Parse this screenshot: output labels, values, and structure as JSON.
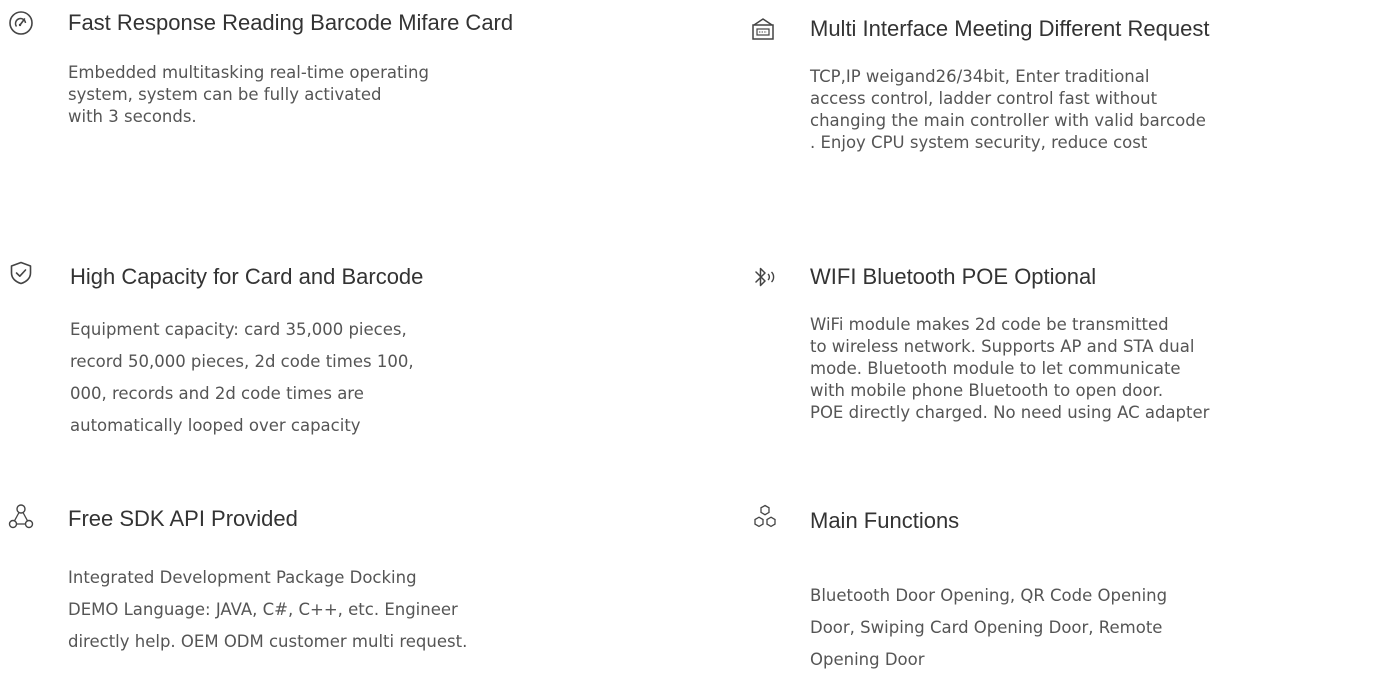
{
  "features": [
    {
      "icon": "gauge-icon",
      "title": "Fast Response Reading Barcode Mifare Card",
      "lines": [
        "Embedded multitasking real-time operating",
        "system, system can be fully activated",
        "with 3 seconds."
      ]
    },
    {
      "icon": "interface-device-icon",
      "title": "Multi Interface Meeting Different Request",
      "lines": [
        "TCP,IP weigand26/34bit, Enter traditional",
        "access control, ladder control fast without",
        "changing the main controller with valid barcode",
        ". Enjoy CPU system security, reduce cost"
      ]
    },
    {
      "icon": "shield-check-icon",
      "title": "High Capacity for Card and Barcode",
      "lines": [
        "Equipment capacity: card 35,000 pieces,",
        "record 50,000 pieces, 2d code times 100,",
        "000, records and 2d code times are",
        "automatically looped over capacity"
      ]
    },
    {
      "icon": "bluetooth-icon",
      "title": "WIFI Bluetooth POE Optional",
      "lines": [
        "WiFi module makes 2d code be transmitted",
        "to wireless network. Supports AP and STA dual",
        "mode. Bluetooth module to let communicate",
        "with mobile phone Bluetooth to open door.",
        "POE directly charged. No need using AC adapter"
      ]
    },
    {
      "icon": "network-nodes-icon",
      "title": "Free SDK API Provided",
      "lines": [
        "Integrated Development Package Docking",
        "DEMO Language: JAVA, C#, C++, etc. Engineer",
        "directly help. OEM ODM customer multi request."
      ]
    },
    {
      "icon": "hexagon-cluster-icon",
      "title": "Main Functions",
      "lines": [
        "Bluetooth Door Opening, QR Code Opening",
        "Door, Swiping Card Opening Door, Remote",
        "Opening Door"
      ]
    }
  ]
}
